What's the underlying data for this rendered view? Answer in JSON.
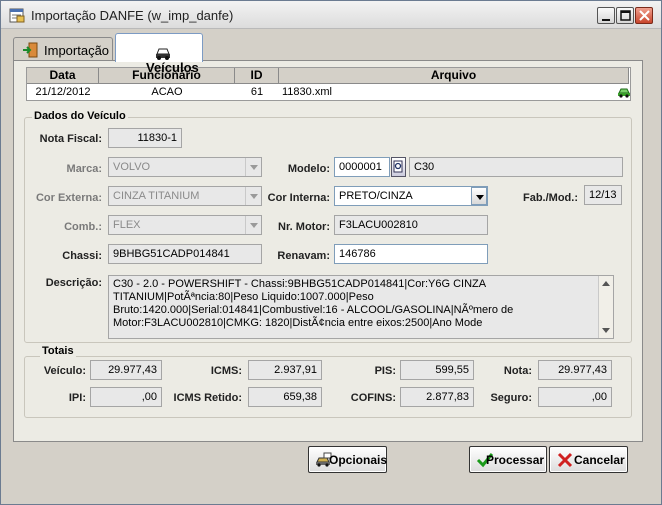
{
  "window": {
    "title": "Importação DANFE (w_imp_danfe)",
    "icons": {
      "app": "document-table-icon",
      "minimize": "minimize-icon",
      "maximize": "maximize-icon",
      "close": "close-icon"
    }
  },
  "tabs": [
    {
      "label": "Importação",
      "icon": "import-door-icon",
      "active": false
    },
    {
      "label": "Veículos",
      "icon": "car-icon",
      "active": true
    }
  ],
  "grid": {
    "columns": [
      "Data",
      "Funcionário",
      "ID",
      "Arquivo"
    ],
    "rows": [
      {
        "data": "21/12/2012",
        "funcionario": "ACAO",
        "id": "61",
        "arquivo": "11830.xml",
        "icon": "green-car-icon"
      }
    ]
  },
  "dados_veiculo": {
    "group_label": "Dados do Veículo",
    "nota_fiscal": {
      "label": "Nota Fiscal:",
      "value": "11830-1"
    },
    "marca": {
      "label": "Marca:",
      "value": "VOLVO"
    },
    "modelo": {
      "label": "Modelo:",
      "code": "0000001",
      "desc": "C30"
    },
    "cor_externa": {
      "label": "Cor Externa:",
      "value": "CINZA TITANIUM"
    },
    "cor_interna": {
      "label": "Cor Interna:",
      "value": "PRETO/CINZA"
    },
    "fab_mod": {
      "label": "Fab./Mod.:",
      "value": "12/13"
    },
    "comb": {
      "label": "Comb.:",
      "value": "FLEX"
    },
    "nr_motor": {
      "label": "Nr. Motor:",
      "value": "F3LACU002810"
    },
    "chassi": {
      "label": "Chassi:",
      "value": "9BHBG51CADP014841"
    },
    "renavam": {
      "label": "Renavam:",
      "value": "146786"
    },
    "descricao": {
      "label": "Descrição:",
      "value": "C30 - 2.0 - POWERSHIFT     -     Chassi:9BHBG51CADP014841|Cor:Y6G CINZA TITANIUM|PotÃªncia:80|Peso Liquido:1007.000|Peso Bruto:1420.000|Serial:014841|Combustivel:16 - ALCOOL/GASOLINA|NÃºmero de Motor:F3LACU002810|CMKG:    1820|DistÃ¢ncia entre eixos:2500|Ano Mode"
    }
  },
  "totais": {
    "group_label": "Totais",
    "veiculo": {
      "label": "Veículo:",
      "value": "29.977,43"
    },
    "icms": {
      "label": "ICMS:",
      "value": "2.937,91"
    },
    "pis": {
      "label": "PIS:",
      "value": "599,55"
    },
    "nota": {
      "label": "Nota:",
      "value": "29.977,43"
    },
    "ipi": {
      "label": "IPI:",
      "value": ",00"
    },
    "icms_retido": {
      "label": "ICMS Retido:",
      "value": "659,38"
    },
    "cofins": {
      "label": "COFINS:",
      "value": "2.877,83"
    },
    "seguro": {
      "label": "Seguro:",
      "value": ",00"
    }
  },
  "buttons": {
    "opcionais": {
      "label": "Opcionais",
      "icon": "car-options-icon"
    },
    "processar": {
      "label": "Processar",
      "icon": "green-check-icon"
    },
    "cancelar": {
      "label": "Cancelar",
      "icon": "red-x-icon"
    }
  }
}
